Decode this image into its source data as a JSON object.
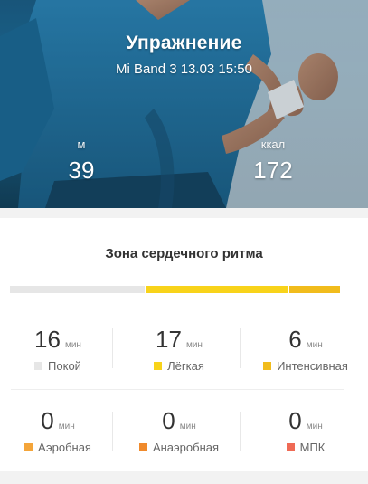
{
  "header": {
    "title": "Упражнение",
    "subtitle": "Mi Band 3 13.03 15:50",
    "distance": {
      "unit": "м",
      "value": "39"
    },
    "calories": {
      "unit": "ккал",
      "value": "172"
    }
  },
  "heart_zone": {
    "title": "Зона сердечного ритма",
    "bar_colors": {
      "empty": "#e6e6e6",
      "light": "#f8d31a",
      "intensive": "#f1bc1c"
    },
    "zones": [
      {
        "value": "16",
        "unit": "мин",
        "label": "Покой",
        "color": "#e6e6e6"
      },
      {
        "value": "17",
        "unit": "мин",
        "label": "Лёгкая",
        "color": "#f8d31a"
      },
      {
        "value": "6",
        "unit": "мин",
        "label": "Интенсивная",
        "color": "#f1bc1c"
      },
      {
        "value": "0",
        "unit": "мин",
        "label": "Аэробная",
        "color": "#f4a53a"
      },
      {
        "value": "0",
        "unit": "мин",
        "label": "Анаэробная",
        "color": "#f08a2c"
      },
      {
        "value": "0",
        "unit": "мин",
        "label": "МПК",
        "color": "#ef6a55"
      }
    ]
  }
}
